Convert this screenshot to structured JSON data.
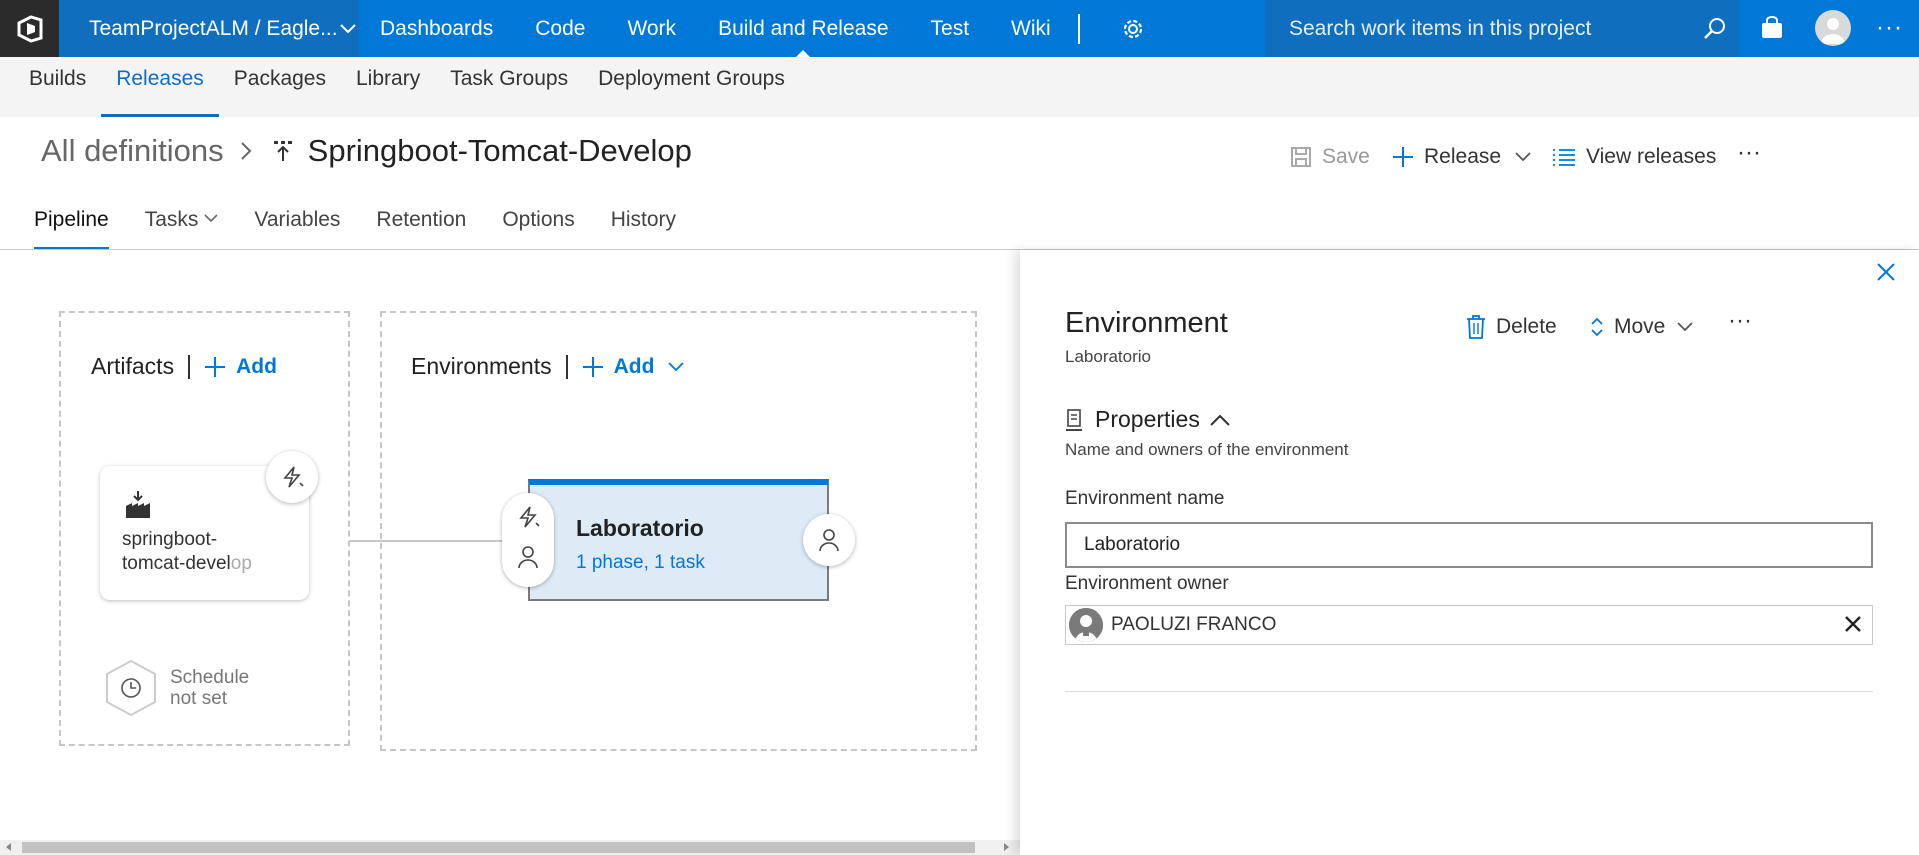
{
  "topnav": {
    "project": "TeamProjectALM / Eagle...",
    "items": [
      {
        "label": "Dashboards"
      },
      {
        "label": "Code"
      },
      {
        "label": "Work"
      },
      {
        "label": "Build and Release",
        "active": true
      },
      {
        "label": "Test"
      },
      {
        "label": "Wiki"
      }
    ],
    "search_placeholder": "Search work items in this project",
    "more": "···"
  },
  "subnav": {
    "items": [
      {
        "label": "Builds"
      },
      {
        "label": "Releases",
        "active": true
      },
      {
        "label": "Packages"
      },
      {
        "label": "Library"
      },
      {
        "label": "Task Groups"
      },
      {
        "label": "Deployment Groups"
      }
    ]
  },
  "header": {
    "breadcrumb_root": "All definitions",
    "separator": ">",
    "title": "Springboot-Tomcat-Develop",
    "save_label": "Save",
    "release_label": "Release",
    "view_releases_label": "View releases",
    "more": "···"
  },
  "tabs": [
    {
      "label": "Pipeline",
      "active": true
    },
    {
      "label": "Tasks",
      "dropdown": true
    },
    {
      "label": "Variables"
    },
    {
      "label": "Retention"
    },
    {
      "label": "Options"
    },
    {
      "label": "History"
    }
  ],
  "pipeline": {
    "artifacts_heading": "Artifacts",
    "environments_heading": "Environments",
    "add_label": "Add",
    "artifact_name_1": "springboot-",
    "artifact_name_2": "tomcat-devel",
    "artifact_name_3": "op",
    "schedule_line1": "Schedule",
    "schedule_line2": "not set",
    "environment": {
      "name": "Laboratorio",
      "summary": "1 phase, 1 task"
    }
  },
  "panel": {
    "title": "Environment",
    "subtitle": "Laboratorio",
    "delete_label": "Delete",
    "move_label": "Move",
    "more": "···",
    "section_title": "Properties",
    "section_desc": "Name and owners of the environment",
    "env_name_label": "Environment name",
    "env_name_value": "Laboratorio",
    "env_owner_label": "Environment owner",
    "env_owner_value": "PAOLUZI FRANCO"
  },
  "colors": {
    "accent": "#0078d7",
    "topbar": "#0078d7",
    "env_card_bg": "#deebf7"
  }
}
